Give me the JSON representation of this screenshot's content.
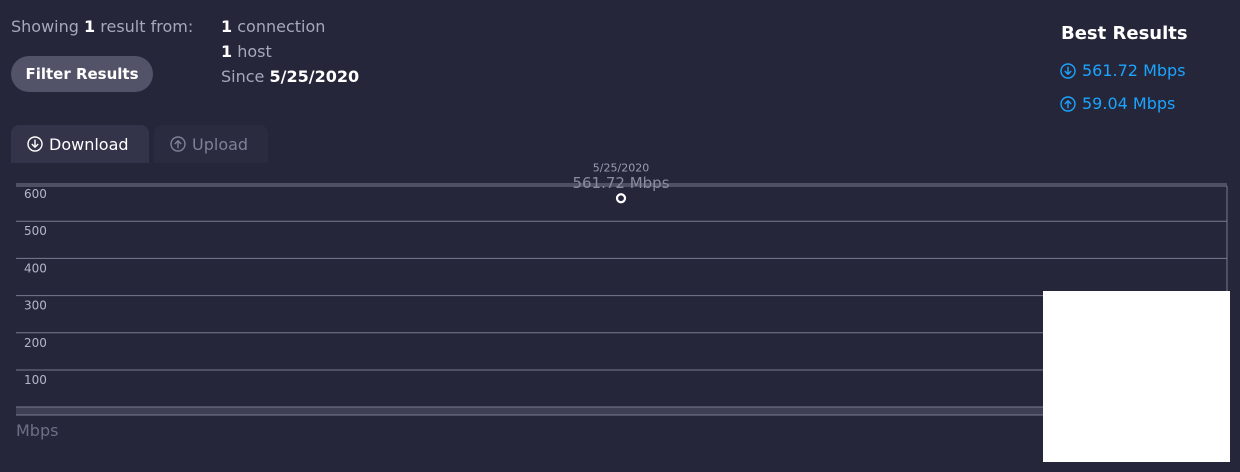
{
  "summary": {
    "showing_prefix": "Showing",
    "showing_count": "1",
    "showing_suffix": "result from:",
    "connection_count": "1",
    "connection_label": "connection",
    "host_count": "1",
    "host_label": "host",
    "since_label": "Since",
    "since_date": "5/25/2020"
  },
  "filter_button": {
    "label": "Filter Results"
  },
  "best_results": {
    "title": "Best Results",
    "download": {
      "icon": "arrow-down-circle-icon",
      "value": "561.72 Mbps"
    },
    "upload": {
      "icon": "arrow-up-circle-icon",
      "value": "59.04 Mbps"
    },
    "accent_color": "#1aa5ff"
  },
  "tabs": [
    {
      "label": "Download",
      "icon": "arrow-down-circle-icon",
      "active": true
    },
    {
      "label": "Upload",
      "icon": "arrow-up-circle-icon",
      "active": false
    }
  ],
  "chart_data": {
    "type": "scatter",
    "x": [
      "5/25/2020"
    ],
    "series": [
      {
        "values": [
          561.72
        ]
      }
    ],
    "point_labels": [
      "561.72 Mbps"
    ],
    "yticks": [
      "600",
      "500",
      "400",
      "300",
      "200",
      "100"
    ],
    "ytick_values": [
      600,
      500,
      400,
      300,
      200,
      100
    ],
    "ylim": [
      0,
      625
    ],
    "ylabel": "Mbps",
    "grid": true
  }
}
